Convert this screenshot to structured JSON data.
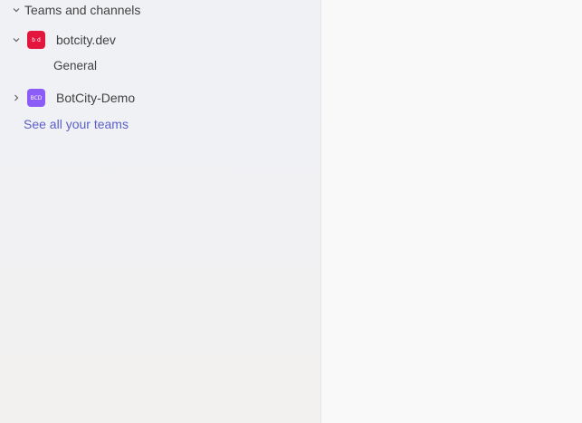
{
  "sidebar": {
    "section_title": "Teams and channels",
    "teams": [
      {
        "name": "botcity.dev",
        "avatar_text": "b d",
        "avatar_color": "#e3173e",
        "expanded": true,
        "channels": [
          "General"
        ]
      },
      {
        "name": "BotCity-Demo",
        "avatar_text": "BCD",
        "avatar_color": "#8b5cf6",
        "expanded": false,
        "channels": []
      }
    ],
    "see_all_link": "See all your teams"
  },
  "colors": {
    "link": "#5b5fc7",
    "text": "#424242"
  },
  "icons": {
    "collapse": "chevron-down-icon",
    "expand": "chevron-right-icon"
  }
}
